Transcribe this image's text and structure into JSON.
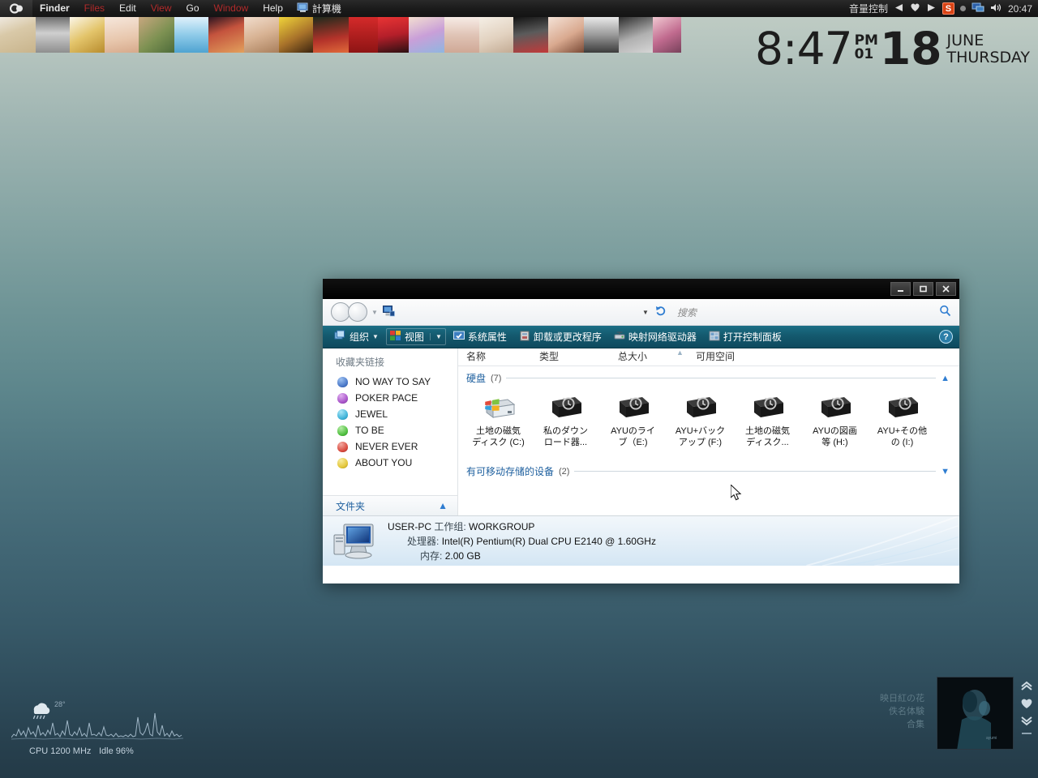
{
  "menubar": {
    "apple_icon": "apple-logo-icon",
    "items": [
      {
        "label": "Finder",
        "style": "bold"
      },
      {
        "label": "Files",
        "style": "red"
      },
      {
        "label": "Edit",
        "style": "normal"
      },
      {
        "label": "View",
        "style": "red"
      },
      {
        "label": "Go",
        "style": "normal"
      },
      {
        "label": "Window",
        "style": "red"
      },
      {
        "label": "Help",
        "style": "normal"
      }
    ],
    "active_app": "計算機",
    "active_app_icon": "computer-icon",
    "right": {
      "volume_label": "音量控制",
      "prev_icon": "previous-track-icon",
      "heart_icon": "heart-icon",
      "next_icon": "next-track-icon",
      "sogou_badge": "S",
      "tray_dot_icon": "tray-dot-icon",
      "network_icon": "network-icon",
      "speaker_icon": "speaker-icon",
      "time": "20:47"
    }
  },
  "clock": {
    "time": "8:47",
    "ampm": "PM",
    "minute_sub": "01",
    "day": "18",
    "month": "JUNE",
    "weekday": "THURSDAY"
  },
  "explorer": {
    "titlebar": {
      "minimize_icon": "minimize-icon",
      "maximize_icon": "maximize-icon",
      "close_icon": "close-icon"
    },
    "nav": {
      "back_icon": "back-arrow-icon",
      "forward_icon": "forward-arrow-icon",
      "history_caret_icon": "chevron-down-icon",
      "address_icon": "computer-icon",
      "address_caret_icon": "chevron-down-icon",
      "refresh_icon": "refresh-icon",
      "search_placeholder": "搜索",
      "search_value": "",
      "search_icon": "search-icon"
    },
    "toolbar": {
      "organize": "组织",
      "organize_icon": "organize-icon",
      "view": "视图",
      "view_icon": "view-icon",
      "system_properties": "系统属性",
      "system_properties_icon": "system-properties-icon",
      "uninstall": "卸载或更改程序",
      "uninstall_icon": "uninstall-icon",
      "map_network_drive": "映射网络驱动器",
      "map_network_drive_icon": "map-network-drive-icon",
      "open_control_panel": "打开控制面板",
      "open_control_panel_icon": "control-panel-icon",
      "help_icon": "help-icon",
      "caret_icon": "chevron-down-icon"
    },
    "sidebar": {
      "title": "收藏夹链接",
      "items": [
        {
          "label": "NO WAY TO SAY",
          "color": "#4b79c9"
        },
        {
          "label": "POKER PACE",
          "color": "#a855c9"
        },
        {
          "label": "JEWEL",
          "color": "#3fb3d9"
        },
        {
          "label": "TO BE",
          "color": "#4fbf3f"
        },
        {
          "label": "NEVER EVER",
          "color": "#d94b3f"
        },
        {
          "label": "ABOUT YOU",
          "color": "#e3c63a"
        }
      ],
      "folders_label": "文件夹",
      "folders_chevron_icon": "chevron-up-icon"
    },
    "columns": [
      {
        "label": "名称"
      },
      {
        "label": "类型"
      },
      {
        "label": "总大小"
      },
      {
        "label": "可用空间"
      }
    ],
    "groups": [
      {
        "label": "硬盘",
        "count": "(7)",
        "chevron_icon": "chevron-up-icon",
        "drives": [
          {
            "line1": "土地の磁気",
            "line2": "ディスク (C:)",
            "icon": "windows-drive-icon"
          },
          {
            "line1": "私のダウン",
            "line2": "ロード器...",
            "icon": "hard-drive-icon"
          },
          {
            "line1": "AYUのライ",
            "line2": "ブ（E:)",
            "icon": "hard-drive-icon"
          },
          {
            "line1": "AYU+バック",
            "line2": "アップ (F:)",
            "icon": "hard-drive-icon"
          },
          {
            "line1": "土地の磁気",
            "line2": "ディスク...",
            "icon": "hard-drive-icon"
          },
          {
            "line1": "AYUの図画",
            "line2": "等 (H:)",
            "icon": "hard-drive-icon"
          },
          {
            "line1": "AYU+その他",
            "line2": "の (I:)",
            "icon": "hard-drive-icon"
          }
        ]
      },
      {
        "label": "有可移动存储的设备",
        "count": "(2)",
        "chevron_icon": "chevron-down-icon",
        "drives": []
      }
    ],
    "status": {
      "pc_icon": "computer-icon",
      "pc_name": "USER-PC",
      "workgroup_label": "工作组:",
      "workgroup_value": "WORKGROUP",
      "cpu_label": "处理器:",
      "cpu_value": "Intel(R) Pentium(R) Dual  CPU  E2140  @ 1.60GHz",
      "mem_label": "内存:",
      "mem_value": "2.00 GB"
    }
  },
  "cpu_widget": {
    "weather_icon": "rain-cloud-icon",
    "temperature": "28°",
    "cpu_label": "CPU 1200 MHz",
    "idle_label": "Idle 96%"
  },
  "music_widget": {
    "title": "映日紅の花",
    "artist": "佚名体験",
    "album": "合集",
    "album_art_icon": "album-art-icon",
    "up_icon": "chevron-up-double-icon",
    "heart_icon": "heart-icon",
    "down_icon": "chevron-down-double-icon"
  },
  "cursor": {
    "icon": "mouse-pointer-icon"
  },
  "colors": {
    "toolbar_teal": "#14596e",
    "link_blue": "#1d5f9e",
    "accent_blue": "#2f7dd1",
    "menu_red": "#b22b2b"
  }
}
